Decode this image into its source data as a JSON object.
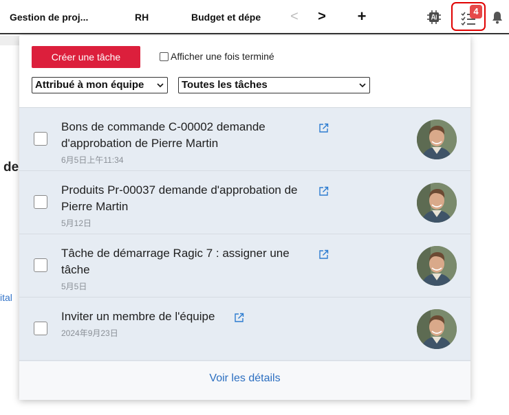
{
  "topbar": {
    "tabs": [
      "Gestion de proj...",
      "RH",
      "Budget et dépe"
    ],
    "prev_glyph": "<",
    "next_glyph": ">",
    "add_glyph": "+",
    "icons": [
      "ai-chip-icon",
      "task-list-icon",
      "bell-icon"
    ],
    "task_badge": "4"
  },
  "background": {
    "fragment_heading": "de",
    "fragment_link": "ital"
  },
  "panel": {
    "create_button": "Créer une tâche",
    "show_done_label": "Afficher une fois terminé",
    "show_done_checked": false,
    "assignee_filter": "Attribué à mon équipe",
    "task_filter": "Toutes les tâches",
    "tasks": [
      {
        "title": "Bons de commande C-00002 demande d'approbation de Pierre Martin",
        "date": "6月5日上午11:34"
      },
      {
        "title": "Produits Pr-00037 demande d'approbation de Pierre Martin",
        "date": "5月12日"
      },
      {
        "title": "Tâche de démarrage Ragic 7 : assigner une tâche",
        "date": "5月5日"
      },
      {
        "title": "Inviter un membre de l'équipe",
        "date": "2024年9月23日"
      }
    ],
    "footer_link": "Voir les détails"
  },
  "colors": {
    "accent_red": "#dc1f3c",
    "badge_red": "#e64848",
    "link_blue": "#2b6ec0",
    "list_bg": "#e6ecf3"
  }
}
